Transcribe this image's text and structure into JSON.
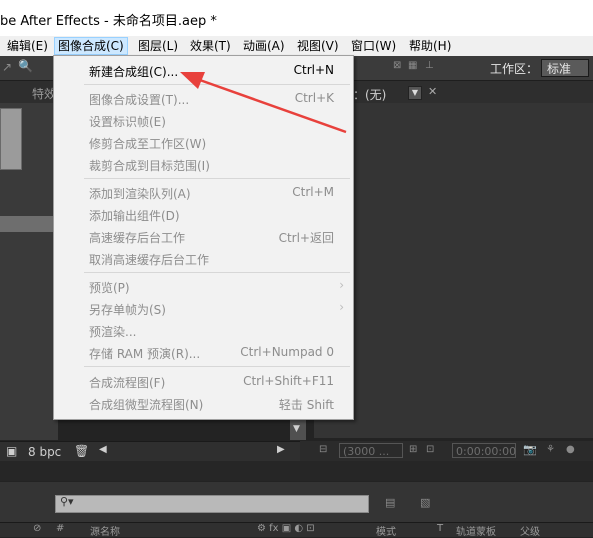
{
  "window": {
    "title": "be After Effects - 未命名项目.aep *"
  },
  "menubar": [
    {
      "label": "编辑(E)",
      "active": false
    },
    {
      "label": "图像合成(C)",
      "active": true
    },
    {
      "label": "图层(L)",
      "active": false
    },
    {
      "label": "效果(T)",
      "active": false
    },
    {
      "label": "动画(A)",
      "active": false
    },
    {
      "label": "视图(V)",
      "active": false
    },
    {
      "label": "窗口(W)",
      "active": false
    },
    {
      "label": "帮助(H)",
      "active": false
    }
  ],
  "toolbar": {
    "workspace_label": "工作区：",
    "workspace_value": "标准"
  },
  "left_panel": {
    "tab": "特效",
    "bpc": "8 bpc"
  },
  "composition_panel": {
    "tab": "成：(无)",
    "zoom": "(3000 ...",
    "timecode": "0:00:00:00"
  },
  "timeline": {
    "headers": [
      "#",
      "源名称",
      "模式",
      "T",
      "轨道蒙板",
      "父级"
    ]
  },
  "comp_menu": {
    "items": [
      {
        "label": "新建合成组(C)...",
        "shortcut": "Ctrl+N",
        "enabled": true,
        "submenu": false
      },
      {
        "separator": true
      },
      {
        "label": "图像合成设置(T)...",
        "shortcut": "Ctrl+K",
        "enabled": false,
        "submenu": false
      },
      {
        "label": "设置标识帧(E)",
        "shortcut": "",
        "enabled": false,
        "submenu": false
      },
      {
        "label": "修剪合成至工作区(W)",
        "shortcut": "",
        "enabled": false,
        "submenu": false
      },
      {
        "label": "裁剪合成到目标范围(I)",
        "shortcut": "",
        "enabled": false,
        "submenu": false
      },
      {
        "separator": true
      },
      {
        "label": "添加到渲染队列(A)",
        "shortcut": "Ctrl+M",
        "enabled": false,
        "submenu": false
      },
      {
        "label": "添加输出组件(D)",
        "shortcut": "",
        "enabled": false,
        "submenu": false
      },
      {
        "label": "高速缓存后台工作",
        "shortcut": "Ctrl+返回",
        "enabled": false,
        "submenu": false
      },
      {
        "label": "取消高速缓存后台工作",
        "shortcut": "",
        "enabled": false,
        "submenu": false
      },
      {
        "separator": true
      },
      {
        "label": "预览(P)",
        "shortcut": "",
        "enabled": false,
        "submenu": true
      },
      {
        "label": "另存单帧为(S)",
        "shortcut": "",
        "enabled": false,
        "submenu": true
      },
      {
        "label": "预渲染...",
        "shortcut": "",
        "enabled": false,
        "submenu": false
      },
      {
        "label": "存储 RAM 预演(R)...",
        "shortcut": "Ctrl+Numpad 0",
        "enabled": false,
        "submenu": false
      },
      {
        "separator": true
      },
      {
        "label": "合成流程图(F)",
        "shortcut": "Ctrl+Shift+F11",
        "enabled": false,
        "submenu": false
      },
      {
        "label": "合成组微型流程图(N)",
        "shortcut": "轻击 Shift",
        "enabled": false,
        "submenu": false
      }
    ]
  },
  "annotation": {
    "color": "#e8413c",
    "icon": "red-arrow-pointer"
  }
}
